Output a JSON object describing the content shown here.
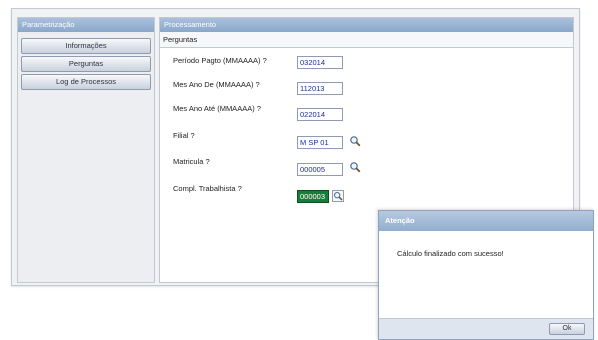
{
  "left_panel": {
    "title": "Parametrização",
    "items": [
      {
        "label": "Informações"
      },
      {
        "label": "Perguntas"
      },
      {
        "label": "Log de Processos"
      }
    ]
  },
  "right_panel": {
    "title": "Processamento",
    "section_title": "Perguntas",
    "fields": [
      {
        "label": "Período Pagto (MMAAAA) ?",
        "value": "032014"
      },
      {
        "label": "Mes Ano De (MMAAAA) ?",
        "value": "112013"
      },
      {
        "label": "Mes Ano Até (MMAAAA) ?",
        "value": "022014"
      },
      {
        "label": "Filial ?",
        "value": "M SP 01",
        "lookup_icon": "magnifier-icon"
      },
      {
        "label": "Matricula ?",
        "value": "000005",
        "lookup_icon": "magnifier-icon"
      },
      {
        "label": "Compl. Trabalhista ?",
        "value": "000003",
        "lookup_icon": "magnifier-icon",
        "selected": true
      }
    ]
  },
  "dialog": {
    "title": "Atenção",
    "message": "Cálculo finalizado com sucesso!",
    "ok_label": "Ok"
  },
  "colors": {
    "header_blue": "#a9c1dd",
    "selection_green": "#177d3a",
    "input_text": "#1a2e9a"
  }
}
